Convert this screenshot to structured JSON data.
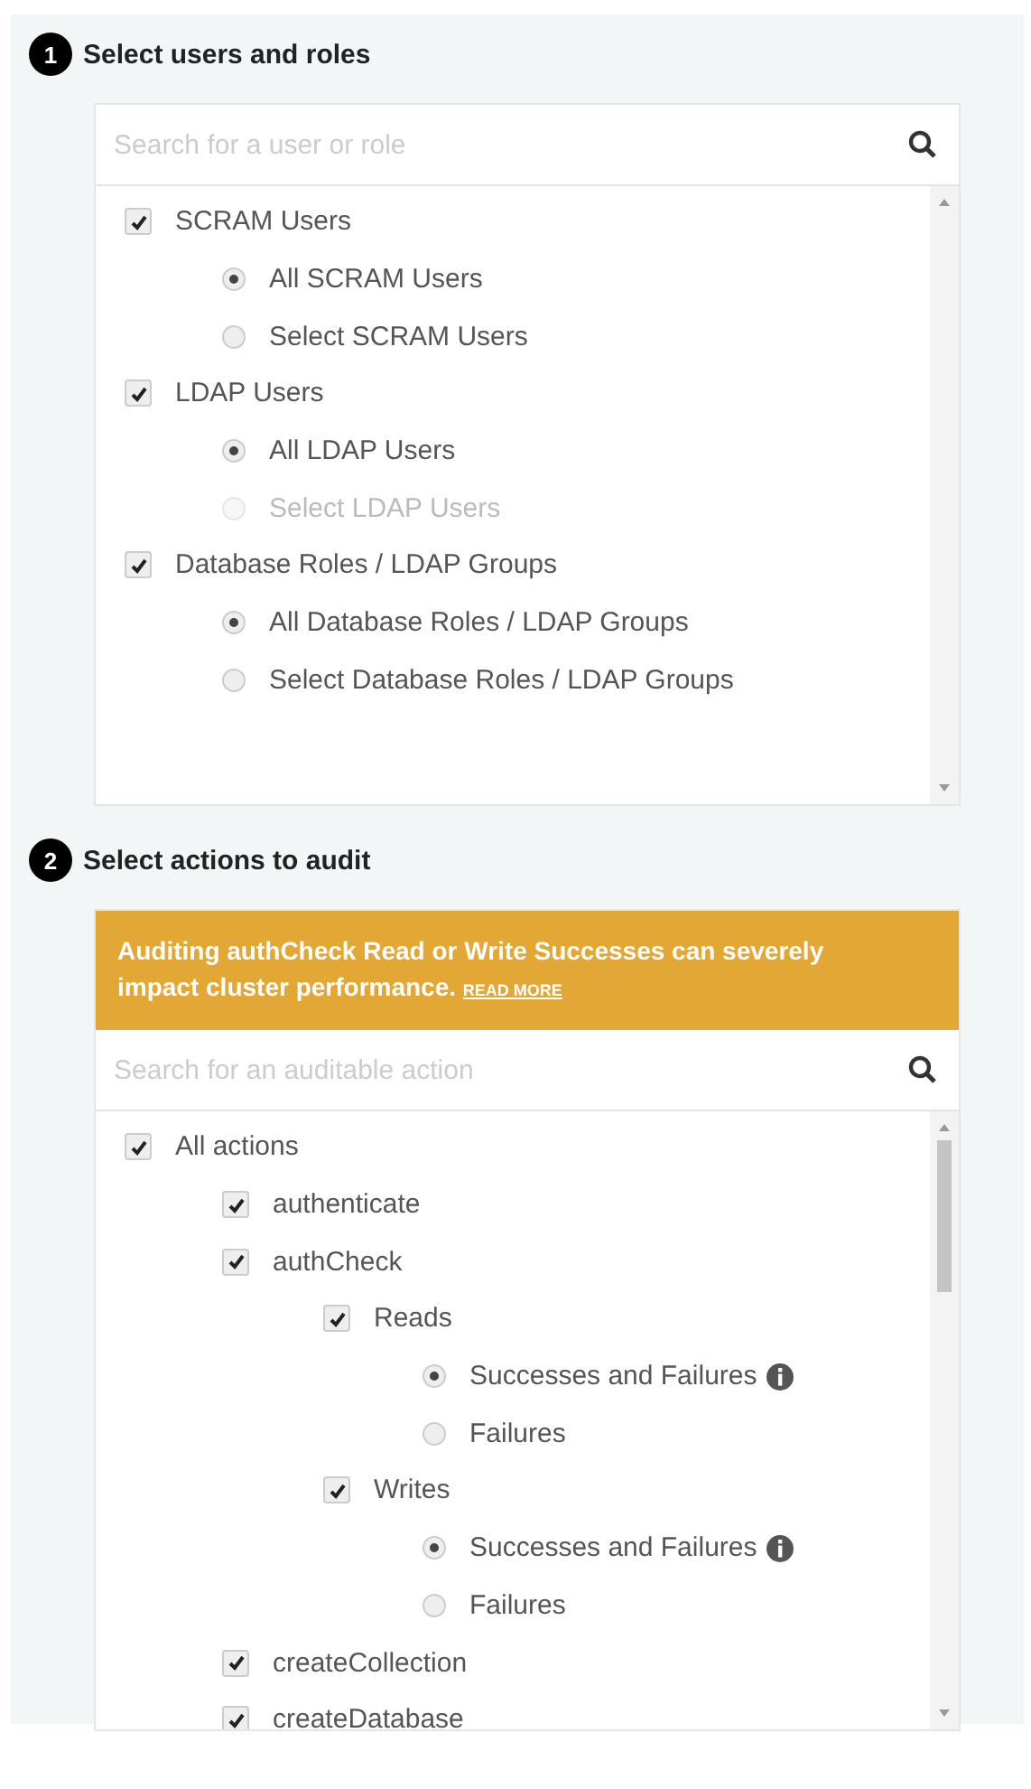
{
  "sections": [
    {
      "number": "1",
      "title": "Select users and roles",
      "search": {
        "placeholder": "Search for a user or role"
      },
      "scrollbar": {
        "thumb": false
      },
      "items": [
        {
          "kind": "checkbox",
          "label": "SCRAM Users",
          "checked": true,
          "children": [
            {
              "kind": "radio",
              "label": "All SCRAM Users",
              "selected": true,
              "disabled": false
            },
            {
              "kind": "radio",
              "label": "Select SCRAM Users",
              "selected": false,
              "disabled": false
            }
          ]
        },
        {
          "kind": "checkbox",
          "label": "LDAP Users",
          "checked": true,
          "children": [
            {
              "kind": "radio",
              "label": "All LDAP Users",
              "selected": true,
              "disabled": false
            },
            {
              "kind": "radio",
              "label": "Select LDAP Users",
              "selected": false,
              "disabled": true
            }
          ]
        },
        {
          "kind": "checkbox",
          "label": "Database Roles / LDAP Groups",
          "checked": true,
          "children": [
            {
              "kind": "radio",
              "label": "All Database Roles / LDAP Groups",
              "selected": true,
              "disabled": false
            },
            {
              "kind": "radio",
              "label": "Select Database Roles / LDAP Groups",
              "selected": false,
              "disabled": false
            }
          ]
        }
      ]
    },
    {
      "number": "2",
      "title": "Select actions to audit",
      "warning": {
        "text": "Auditing authCheck Read or Write Successes can severely impact cluster performance.",
        "link": "READ MORE"
      },
      "search": {
        "placeholder": "Search for an auditable action"
      },
      "scrollbar": {
        "thumb": true
      },
      "items": [
        {
          "kind": "checkbox",
          "label": "All actions",
          "checked": true,
          "children": [
            {
              "kind": "checkbox",
              "label": "authenticate",
              "checked": true
            },
            {
              "kind": "checkbox",
              "label": "authCheck",
              "checked": true,
              "children": [
                {
                  "kind": "checkbox",
                  "label": "Reads",
                  "checked": true,
                  "children": [
                    {
                      "kind": "radio",
                      "label": "Successes and Failures",
                      "selected": true,
                      "disabled": false,
                      "info": true
                    },
                    {
                      "kind": "radio",
                      "label": "Failures",
                      "selected": false,
                      "disabled": false
                    }
                  ]
                },
                {
                  "kind": "checkbox",
                  "label": "Writes",
                  "checked": true,
                  "children": [
                    {
                      "kind": "radio",
                      "label": "Successes and Failures",
                      "selected": true,
                      "disabled": false,
                      "info": true
                    },
                    {
                      "kind": "radio",
                      "label": "Failures",
                      "selected": false,
                      "disabled": false
                    }
                  ]
                }
              ]
            },
            {
              "kind": "checkbox",
              "label": "createCollection",
              "checked": true
            },
            {
              "kind": "checkbox",
              "label": "createDatabase",
              "checked": true
            }
          ]
        }
      ]
    }
  ]
}
